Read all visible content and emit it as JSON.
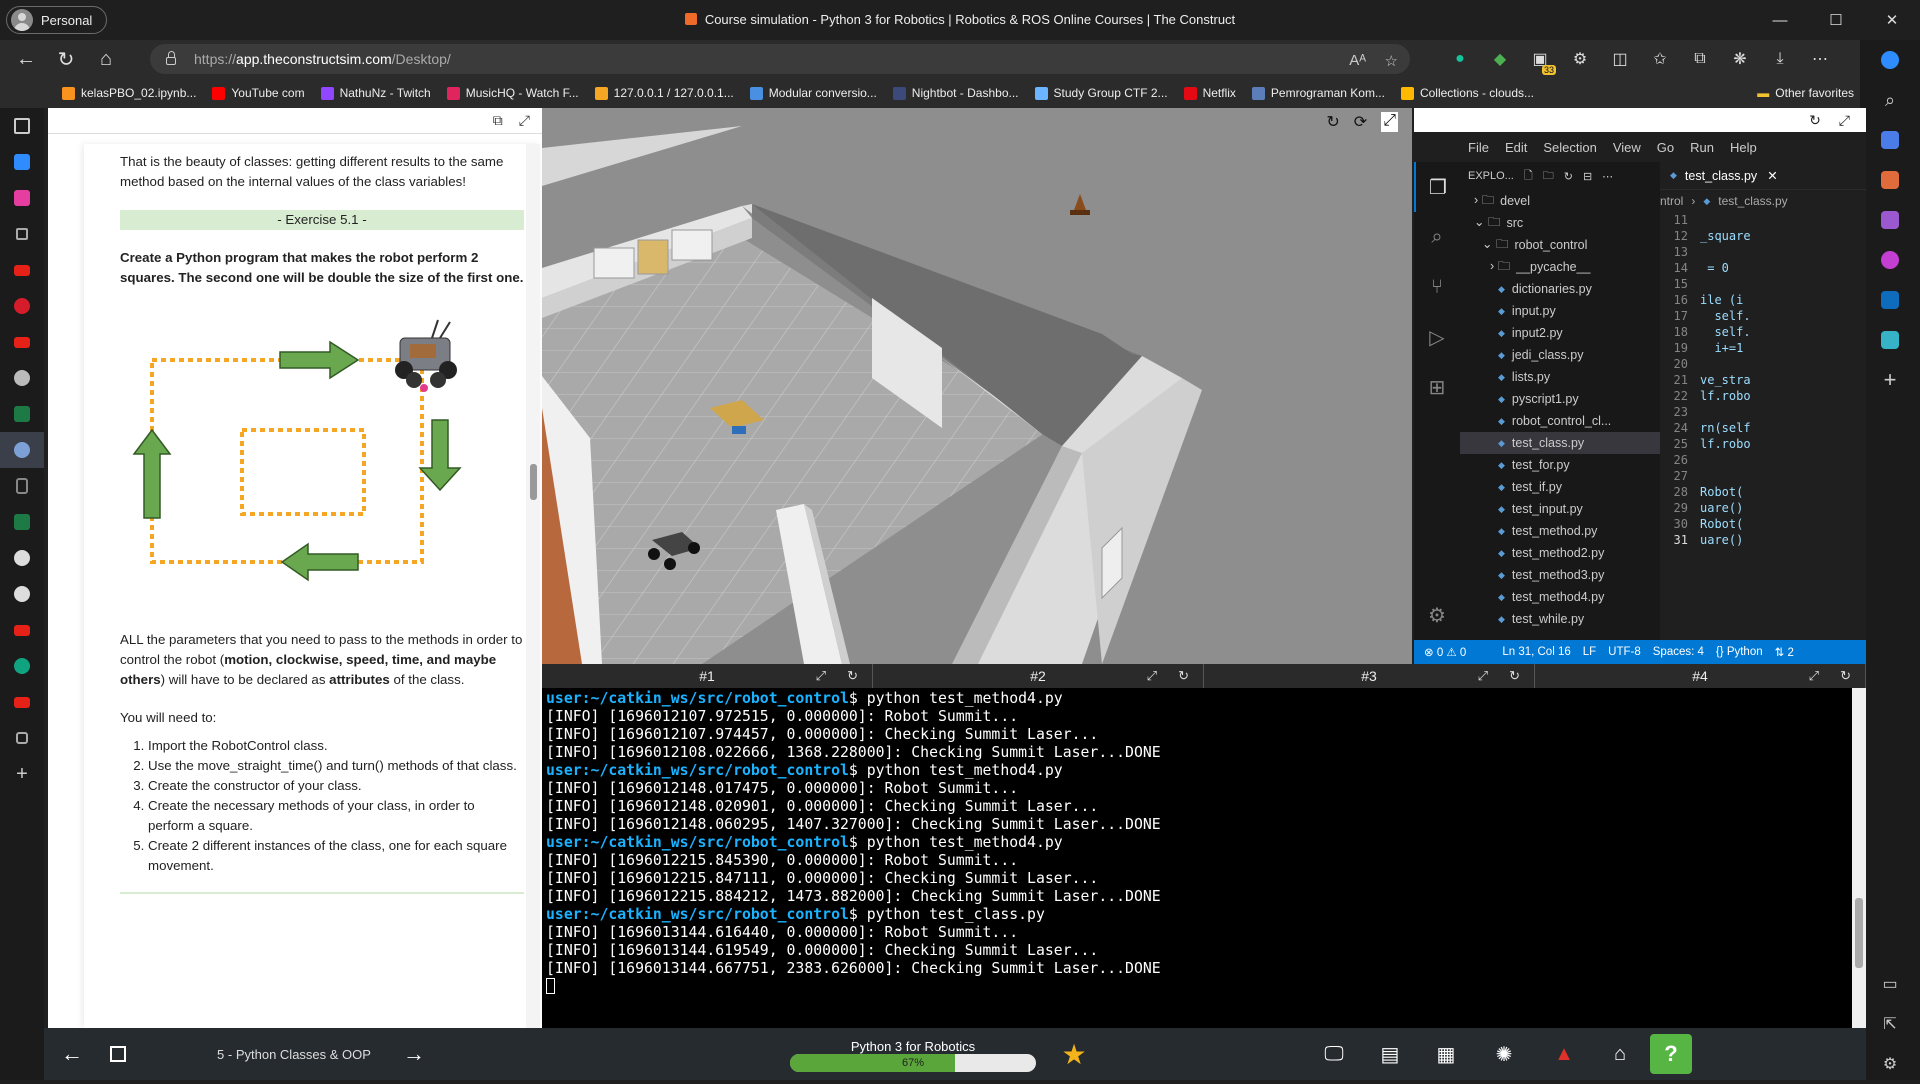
{
  "browser": {
    "profile": "Personal",
    "window_title": "Course simulation - Python 3 for Robotics | Robotics & ROS Online Courses | The Construct",
    "url_prefix": "https://",
    "url_host": "app.theconstructsim.com",
    "url_path": "/Desktop/",
    "bookmarks": [
      "kelasPBO_02.ipynb...",
      "YouTube com",
      "NathuNz - Twitch",
      "MusicHQ - Watch F...",
      "127.0.0.1 / 127.0.0.1...",
      "Modular conversio...",
      "Nightbot - Dashbo...",
      "Study Group CTF 2...",
      "Netflix",
      "Pemrograman Kom...",
      "Collections - clouds..."
    ],
    "bookmark_colors": [
      "#f7931e",
      "#ff0000",
      "#9146ff",
      "#e0245e",
      "#f5a623",
      "#4a90e2",
      "#3b4a7a",
      "#6cb4ff",
      "#e50914",
      "#5b7db8",
      "#ffb900"
    ],
    "other_favorites": "Other favorites",
    "badge_count": "33"
  },
  "notebook": {
    "para1": "That is the beauty of classes: getting different results to the same method based on the internal values of the class variables!",
    "exercise_title": "- Exercise 5.1 -",
    "task": "Create a Python program that makes the robot perform 2 squares. The second one will be double the size of the first one.",
    "params_pre": "ALL the parameters that you need to pass to the methods in order to control the robot (",
    "params_bold": "motion, clockwise, speed, time, and maybe others",
    "params_mid": ") will have to be declared as ",
    "params_bold2": "attributes",
    "params_post": " of the class.",
    "need": "You will need to:",
    "steps": [
      "Import the RobotControl class.",
      "Use the move_straight_time() and turn() methods of that class.",
      "Create the constructor of your class.",
      "Create the necessary methods of your class, in order to perform a square.",
      "Create 2 different instances of the class, one for each square movement."
    ]
  },
  "vscode": {
    "menu": [
      "File",
      "Edit",
      "Selection",
      "View",
      "Go",
      "Run",
      "Help"
    ],
    "explorer_title": "EXPLO...",
    "tree": [
      {
        "label": "devel",
        "type": "folder",
        "indent": 1,
        "open": false
      },
      {
        "label": "src",
        "type": "folder",
        "indent": 1,
        "open": true
      },
      {
        "label": "robot_control",
        "type": "folder",
        "indent": 2,
        "open": true
      },
      {
        "label": "__pycache__",
        "type": "folder",
        "indent": 3,
        "open": false
      },
      {
        "label": "dictionaries.py",
        "type": "file",
        "indent": 4
      },
      {
        "label": "input.py",
        "type": "file",
        "indent": 4
      },
      {
        "label": "input2.py",
        "type": "file",
        "indent": 4
      },
      {
        "label": "jedi_class.py",
        "type": "file",
        "indent": 4
      },
      {
        "label": "lists.py",
        "type": "file",
        "indent": 4
      },
      {
        "label": "pyscript1.py",
        "type": "file",
        "indent": 4
      },
      {
        "label": "robot_control_cl...",
        "type": "file",
        "indent": 4
      },
      {
        "label": "test_class.py",
        "type": "file",
        "indent": 4,
        "selected": true
      },
      {
        "label": "test_for.py",
        "type": "file",
        "indent": 4
      },
      {
        "label": "test_if.py",
        "type": "file",
        "indent": 4
      },
      {
        "label": "test_input.py",
        "type": "file",
        "indent": 4
      },
      {
        "label": "test_method.py",
        "type": "file",
        "indent": 4
      },
      {
        "label": "test_method2.py",
        "type": "file",
        "indent": 4
      },
      {
        "label": "test_method3.py",
        "type": "file",
        "indent": 4
      },
      {
        "label": "test_method4.py",
        "type": "file",
        "indent": 4
      },
      {
        "label": "test_while.py",
        "type": "file",
        "indent": 4
      }
    ],
    "tab": "test_class.py",
    "crumb1": "ntrol",
    "crumb2": "test_class.py",
    "code": [
      {
        "n": "11",
        "t": ""
      },
      {
        "n": "12",
        "t": "_square"
      },
      {
        "n": "13",
        "t": ""
      },
      {
        "n": "14",
        "t": " = 0"
      },
      {
        "n": "15",
        "t": ""
      },
      {
        "n": "16",
        "t": "ile (i"
      },
      {
        "n": "17",
        "t": "  self."
      },
      {
        "n": "18",
        "t": "  self."
      },
      {
        "n": "19",
        "t": "  i+=1"
      },
      {
        "n": "20",
        "t": ""
      },
      {
        "n": "21",
        "t": "ve_stra"
      },
      {
        "n": "22",
        "t": "lf.robo"
      },
      {
        "n": "23",
        "t": ""
      },
      {
        "n": "24",
        "t": "rn(self"
      },
      {
        "n": "25",
        "t": "lf.robo"
      },
      {
        "n": "26",
        "t": ""
      },
      {
        "n": "27",
        "t": ""
      },
      {
        "n": "28",
        "t": "Robot("
      },
      {
        "n": "29",
        "t": "uare()"
      },
      {
        "n": "30",
        "t": "Robot("
      },
      {
        "n": "31",
        "t": "uare()"
      }
    ],
    "status": {
      "errors": "⊗ 0 ⚠ 0",
      "position": "Ln 31, Col 16",
      "eol": "LF",
      "encoding": "UTF-8",
      "spaces": "Spaces: 4",
      "lang": "Python",
      "ports": "2"
    }
  },
  "terminal": {
    "tabs": [
      "#1",
      "#2",
      "#3",
      "#4"
    ],
    "lines": [
      {
        "kind": "prompt",
        "path": "user:~/catkin_ws/src/robot_control",
        "cmd": "$ python test_method4.py"
      },
      {
        "kind": "out",
        "text": "[INFO] [1696012107.972515, 0.000000]: Robot Summit..."
      },
      {
        "kind": "out",
        "text": "[INFO] [1696012107.974457, 0.000000]: Checking Summit Laser..."
      },
      {
        "kind": "out",
        "text": "[INFO] [1696012108.022666, 1368.228000]: Checking Summit Laser...DONE"
      },
      {
        "kind": "prompt",
        "path": "user:~/catkin_ws/src/robot_control",
        "cmd": "$ python test_method4.py"
      },
      {
        "kind": "out",
        "text": "[INFO] [1696012148.017475, 0.000000]: Robot Summit..."
      },
      {
        "kind": "out",
        "text": "[INFO] [1696012148.020901, 0.000000]: Checking Summit Laser..."
      },
      {
        "kind": "out",
        "text": "[INFO] [1696012148.060295, 1407.327000]: Checking Summit Laser...DONE"
      },
      {
        "kind": "prompt",
        "path": "user:~/catkin_ws/src/robot_control",
        "cmd": "$ python test_method4.py"
      },
      {
        "kind": "out",
        "text": "[INFO] [1696012215.845390, 0.000000]: Robot Summit..."
      },
      {
        "kind": "out",
        "text": "[INFO] [1696012215.847111, 0.000000]: Checking Summit Laser..."
      },
      {
        "kind": "out",
        "text": "[INFO] [1696012215.884212, 1473.882000]: Checking Summit Laser...DONE"
      },
      {
        "kind": "prompt",
        "path": "user:~/catkin_ws/src/robot_control",
        "cmd": "$ python test_class.py"
      },
      {
        "kind": "out",
        "text": "[INFO] [1696013144.616440, 0.000000]: Robot Summit..."
      },
      {
        "kind": "out",
        "text": "[INFO] [1696013144.619549, 0.000000]: Checking Summit Laser..."
      },
      {
        "kind": "out",
        "text": "[INFO] [1696013144.667751, 2383.626000]: Checking Summit Laser...DONE"
      }
    ]
  },
  "bottom": {
    "lesson": "5 - Python Classes & OOP",
    "course": "Python 3 for Robotics",
    "progress_label": "67%",
    "progress": 0.67
  },
  "colors": {
    "accent": "#0078d4",
    "progress_green": "#5aa63a",
    "prompt_blue": "#1ab3ff",
    "exercise_bg": "#d8ecd1",
    "arrow_green": "#6aa84f",
    "dash_orange": "#f5a623"
  }
}
